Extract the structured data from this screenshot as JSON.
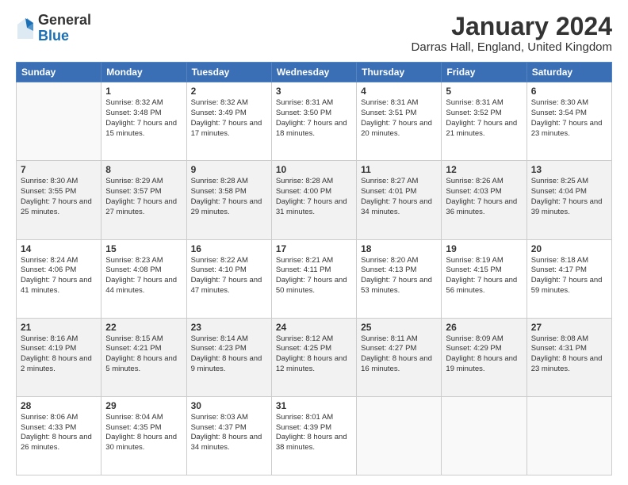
{
  "logo": {
    "general": "General",
    "blue": "Blue"
  },
  "title": "January 2024",
  "location": "Darras Hall, England, United Kingdom",
  "weekdays": [
    "Sunday",
    "Monday",
    "Tuesday",
    "Wednesday",
    "Thursday",
    "Friday",
    "Saturday"
  ],
  "weeks": [
    [
      {
        "day": "",
        "sunrise": "",
        "sunset": "",
        "daylight": ""
      },
      {
        "day": "1",
        "sunrise": "Sunrise: 8:32 AM",
        "sunset": "Sunset: 3:48 PM",
        "daylight": "Daylight: 7 hours and 15 minutes."
      },
      {
        "day": "2",
        "sunrise": "Sunrise: 8:32 AM",
        "sunset": "Sunset: 3:49 PM",
        "daylight": "Daylight: 7 hours and 17 minutes."
      },
      {
        "day": "3",
        "sunrise": "Sunrise: 8:31 AM",
        "sunset": "Sunset: 3:50 PM",
        "daylight": "Daylight: 7 hours and 18 minutes."
      },
      {
        "day": "4",
        "sunrise": "Sunrise: 8:31 AM",
        "sunset": "Sunset: 3:51 PM",
        "daylight": "Daylight: 7 hours and 20 minutes."
      },
      {
        "day": "5",
        "sunrise": "Sunrise: 8:31 AM",
        "sunset": "Sunset: 3:52 PM",
        "daylight": "Daylight: 7 hours and 21 minutes."
      },
      {
        "day": "6",
        "sunrise": "Sunrise: 8:30 AM",
        "sunset": "Sunset: 3:54 PM",
        "daylight": "Daylight: 7 hours and 23 minutes."
      }
    ],
    [
      {
        "day": "7",
        "sunrise": "Sunrise: 8:30 AM",
        "sunset": "Sunset: 3:55 PM",
        "daylight": "Daylight: 7 hours and 25 minutes."
      },
      {
        "day": "8",
        "sunrise": "Sunrise: 8:29 AM",
        "sunset": "Sunset: 3:57 PM",
        "daylight": "Daylight: 7 hours and 27 minutes."
      },
      {
        "day": "9",
        "sunrise": "Sunrise: 8:28 AM",
        "sunset": "Sunset: 3:58 PM",
        "daylight": "Daylight: 7 hours and 29 minutes."
      },
      {
        "day": "10",
        "sunrise": "Sunrise: 8:28 AM",
        "sunset": "Sunset: 4:00 PM",
        "daylight": "Daylight: 7 hours and 31 minutes."
      },
      {
        "day": "11",
        "sunrise": "Sunrise: 8:27 AM",
        "sunset": "Sunset: 4:01 PM",
        "daylight": "Daylight: 7 hours and 34 minutes."
      },
      {
        "day": "12",
        "sunrise": "Sunrise: 8:26 AM",
        "sunset": "Sunset: 4:03 PM",
        "daylight": "Daylight: 7 hours and 36 minutes."
      },
      {
        "day": "13",
        "sunrise": "Sunrise: 8:25 AM",
        "sunset": "Sunset: 4:04 PM",
        "daylight": "Daylight: 7 hours and 39 minutes."
      }
    ],
    [
      {
        "day": "14",
        "sunrise": "Sunrise: 8:24 AM",
        "sunset": "Sunset: 4:06 PM",
        "daylight": "Daylight: 7 hours and 41 minutes."
      },
      {
        "day": "15",
        "sunrise": "Sunrise: 8:23 AM",
        "sunset": "Sunset: 4:08 PM",
        "daylight": "Daylight: 7 hours and 44 minutes."
      },
      {
        "day": "16",
        "sunrise": "Sunrise: 8:22 AM",
        "sunset": "Sunset: 4:10 PM",
        "daylight": "Daylight: 7 hours and 47 minutes."
      },
      {
        "day": "17",
        "sunrise": "Sunrise: 8:21 AM",
        "sunset": "Sunset: 4:11 PM",
        "daylight": "Daylight: 7 hours and 50 minutes."
      },
      {
        "day": "18",
        "sunrise": "Sunrise: 8:20 AM",
        "sunset": "Sunset: 4:13 PM",
        "daylight": "Daylight: 7 hours and 53 minutes."
      },
      {
        "day": "19",
        "sunrise": "Sunrise: 8:19 AM",
        "sunset": "Sunset: 4:15 PM",
        "daylight": "Daylight: 7 hours and 56 minutes."
      },
      {
        "day": "20",
        "sunrise": "Sunrise: 8:18 AM",
        "sunset": "Sunset: 4:17 PM",
        "daylight": "Daylight: 7 hours and 59 minutes."
      }
    ],
    [
      {
        "day": "21",
        "sunrise": "Sunrise: 8:16 AM",
        "sunset": "Sunset: 4:19 PM",
        "daylight": "Daylight: 8 hours and 2 minutes."
      },
      {
        "day": "22",
        "sunrise": "Sunrise: 8:15 AM",
        "sunset": "Sunset: 4:21 PM",
        "daylight": "Daylight: 8 hours and 5 minutes."
      },
      {
        "day": "23",
        "sunrise": "Sunrise: 8:14 AM",
        "sunset": "Sunset: 4:23 PM",
        "daylight": "Daylight: 8 hours and 9 minutes."
      },
      {
        "day": "24",
        "sunrise": "Sunrise: 8:12 AM",
        "sunset": "Sunset: 4:25 PM",
        "daylight": "Daylight: 8 hours and 12 minutes."
      },
      {
        "day": "25",
        "sunrise": "Sunrise: 8:11 AM",
        "sunset": "Sunset: 4:27 PM",
        "daylight": "Daylight: 8 hours and 16 minutes."
      },
      {
        "day": "26",
        "sunrise": "Sunrise: 8:09 AM",
        "sunset": "Sunset: 4:29 PM",
        "daylight": "Daylight: 8 hours and 19 minutes."
      },
      {
        "day": "27",
        "sunrise": "Sunrise: 8:08 AM",
        "sunset": "Sunset: 4:31 PM",
        "daylight": "Daylight: 8 hours and 23 minutes."
      }
    ],
    [
      {
        "day": "28",
        "sunrise": "Sunrise: 8:06 AM",
        "sunset": "Sunset: 4:33 PM",
        "daylight": "Daylight: 8 hours and 26 minutes."
      },
      {
        "day": "29",
        "sunrise": "Sunrise: 8:04 AM",
        "sunset": "Sunset: 4:35 PM",
        "daylight": "Daylight: 8 hours and 30 minutes."
      },
      {
        "day": "30",
        "sunrise": "Sunrise: 8:03 AM",
        "sunset": "Sunset: 4:37 PM",
        "daylight": "Daylight: 8 hours and 34 minutes."
      },
      {
        "day": "31",
        "sunrise": "Sunrise: 8:01 AM",
        "sunset": "Sunset: 4:39 PM",
        "daylight": "Daylight: 8 hours and 38 minutes."
      },
      {
        "day": "",
        "sunrise": "",
        "sunset": "",
        "daylight": ""
      },
      {
        "day": "",
        "sunrise": "",
        "sunset": "",
        "daylight": ""
      },
      {
        "day": "",
        "sunrise": "",
        "sunset": "",
        "daylight": ""
      }
    ]
  ]
}
